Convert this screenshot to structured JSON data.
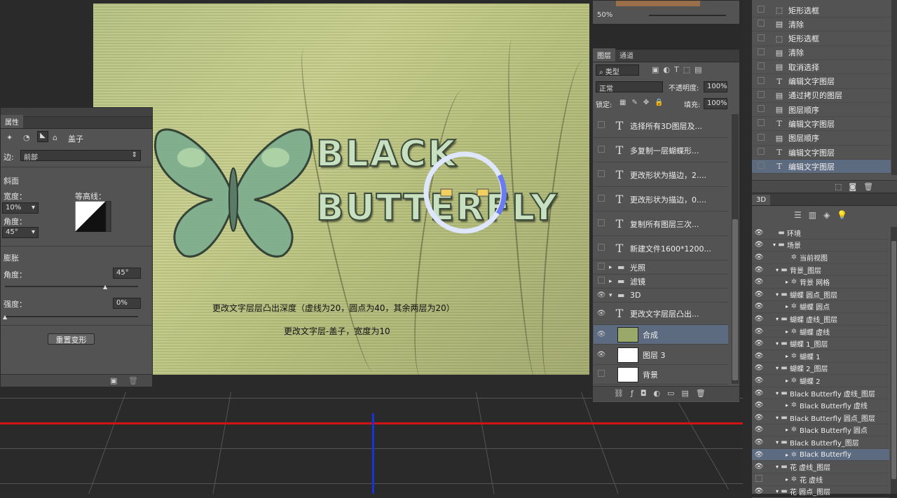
{
  "canvas": {
    "title_line1": "BLACK",
    "title_line2": "BUTTERFLY",
    "note1": "更改文字层层凸出深度（虚线为20，圆点为40，其余两层为20）",
    "note2": "更改文字层-盖子，宽度为10"
  },
  "properties": {
    "tab": "属性",
    "mode_label": "盖子",
    "side_label": "边:",
    "side_value": "前部",
    "bevel_heading": "斜面",
    "width_label": "宽度：",
    "width_value": "10%",
    "contour_label": "等高线：",
    "angle_label": "角度：",
    "angle_value": "45°",
    "inflate_heading": "膨胀",
    "inflate_angle_label": "角度：",
    "inflate_angle_value": "45°",
    "strength_label": "强度：",
    "strength_value": "0%",
    "reset_button": "重置变形"
  },
  "layers": {
    "tabs": [
      "图层",
      "通道"
    ],
    "filter_value": "类型",
    "blend_mode": "正常",
    "opacity_label": "不透明度:",
    "opacity_value": "100%",
    "lock_label": "锁定:",
    "fill_label": "填充:",
    "fill_value": "100%",
    "zoom": "50%",
    "rows": [
      {
        "name": "选择所有3D图层及...",
        "type": "text"
      },
      {
        "name": "多复制一层蝴蝶形...",
        "type": "text"
      },
      {
        "name": "更改形状为描边，2....",
        "type": "text"
      },
      {
        "name": "更改形状为描边，0....",
        "type": "text"
      },
      {
        "name": "复制所有图层三次...",
        "type": "text"
      },
      {
        "name": "新建文件1600*1200...",
        "type": "text"
      }
    ],
    "groups": [
      "光照",
      "滤镜",
      "3D"
    ],
    "rows2": [
      {
        "name": "更改文字层层凸出..."
      },
      {
        "name": "合成"
      },
      {
        "name": "图层 3"
      },
      {
        "name": "背景"
      }
    ]
  },
  "history": {
    "items": [
      "矩形选框",
      "清除",
      "矩形选框",
      "清除",
      "取消选择",
      "编辑文字图层",
      "通过拷贝的图层",
      "图层顺序",
      "编辑文字图层",
      "图层顺序",
      "编辑文字图层",
      "编辑文字图层"
    ]
  },
  "panel3d": {
    "tab": "3D",
    "items": [
      "环境",
      "场景",
      "当前视图",
      "背景_图层",
      "背景 网格",
      "蝴蝶 圆点_图层",
      "蝴蝶 圆点",
      "蝴蝶 虚线_图层",
      "蝴蝶 虚线",
      "蝴蝶 1_图层",
      "蝴蝶 1",
      "蝴蝶 2_图层",
      "蝴蝶 2",
      "Black Butterfly 虚线_图层",
      "Black Butterfly 虚线",
      "Black Butterfly 圆点_图层",
      "Black Butterfly 圆点",
      "Black Butterfly_图层",
      "Black Butterfly",
      "花 虚线_图层",
      "花 虚线",
      "花 圆点_图层"
    ]
  }
}
